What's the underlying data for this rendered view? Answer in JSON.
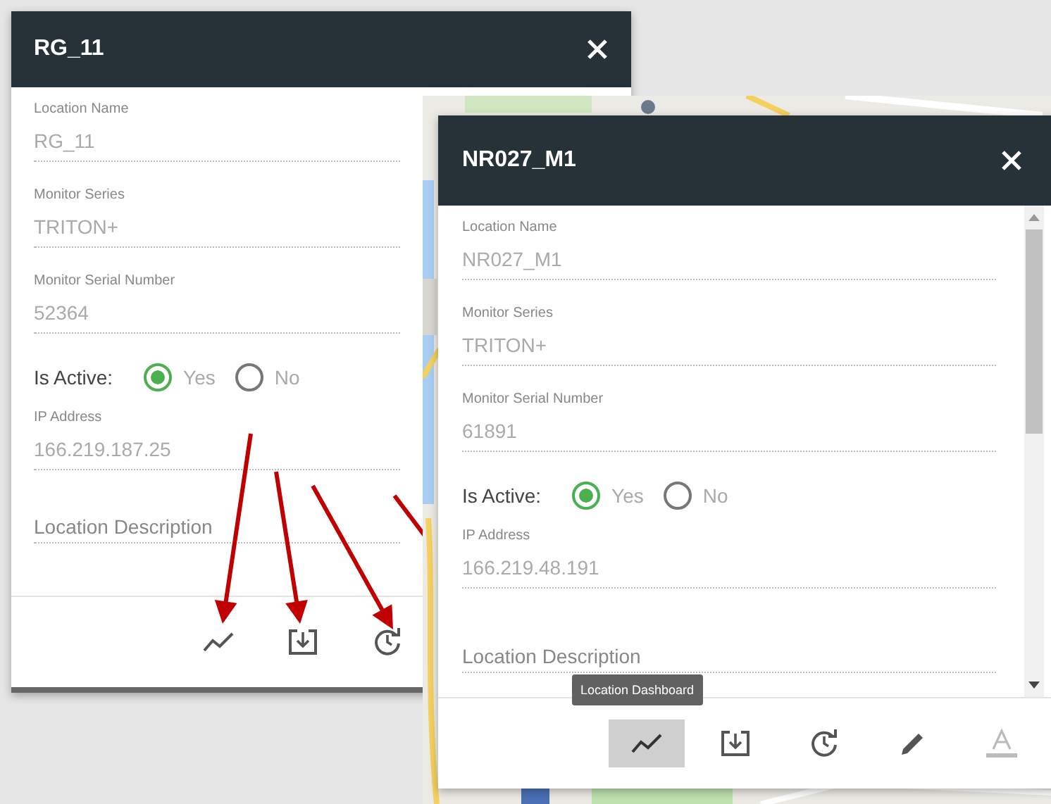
{
  "dialogs": [
    {
      "title": "RG_11",
      "rows": [
        {
          "kind": "field",
          "label": "Location Name",
          "value": "RG_11"
        },
        {
          "kind": "field",
          "label": "Monitor Series",
          "value": "TRITON+"
        },
        {
          "kind": "field",
          "label": "Monitor Serial Number",
          "value": "52364"
        },
        {
          "kind": "radio",
          "label": "Is Active:",
          "options": [
            {
              "label": "Yes",
              "selected": true
            },
            {
              "label": "No",
              "selected": false
            }
          ]
        },
        {
          "kind": "field",
          "label": "IP Address",
          "value": "166.219.187.25"
        },
        {
          "kind": "textarea",
          "placeholder": "Location Description"
        }
      ],
      "actions": [
        {
          "kind": "chart",
          "hovered": false,
          "disabled": false
        },
        {
          "kind": "download",
          "hovered": false,
          "disabled": false
        },
        {
          "kind": "history",
          "hovered": false,
          "disabled": false
        }
      ]
    },
    {
      "title": "NR027_M1",
      "rows": [
        {
          "kind": "field",
          "label": "Location Name",
          "value": "NR027_M1"
        },
        {
          "kind": "field",
          "label": "Monitor Series",
          "value": "TRITON+"
        },
        {
          "kind": "field",
          "label": "Monitor Serial Number",
          "value": "61891"
        },
        {
          "kind": "radio",
          "label": "Is Active:",
          "options": [
            {
              "label": "Yes",
              "selected": true
            },
            {
              "label": "No",
              "selected": false
            }
          ]
        },
        {
          "kind": "field",
          "label": "IP Address",
          "value": "166.219.48.191"
        },
        {
          "kind": "textarea",
          "placeholder": "Location Description"
        }
      ],
      "tooltip": "Location Dashboard",
      "actions": [
        {
          "kind": "chart",
          "hovered": true,
          "disabled": false
        },
        {
          "kind": "download",
          "hovered": false,
          "disabled": false
        },
        {
          "kind": "history",
          "hovered": false,
          "disabled": false
        },
        {
          "kind": "edit",
          "hovered": false,
          "disabled": false
        },
        {
          "kind": "text-format",
          "hovered": false,
          "disabled": true
        }
      ]
    }
  ]
}
